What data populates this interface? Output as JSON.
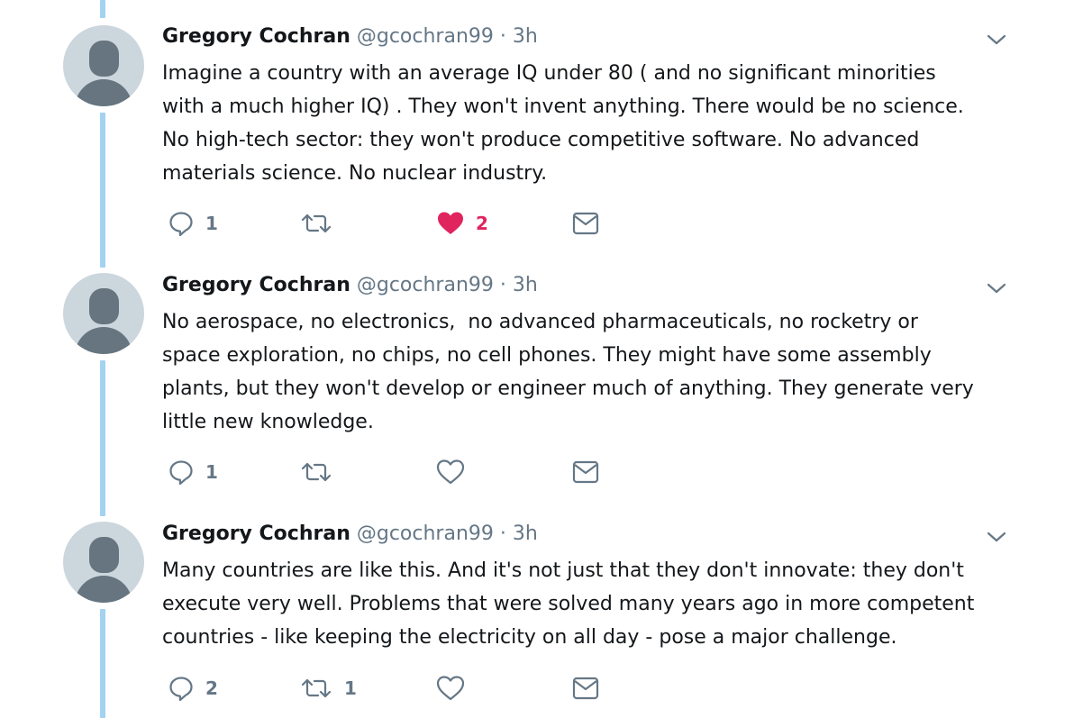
{
  "tweets": [
    {
      "name": "Gregory Cochran",
      "handle": "@gcochran99",
      "separator": "·",
      "time": "3h",
      "text": "Imagine a country with an average IQ under 80 ( and no significant minorities\nwith a much higher IQ) . They won't invent anything. There would be no science.\nNo high-tech sector: they won't produce competitive software. No advanced\nmaterials science. No nuclear industry.",
      "reply_count": "1",
      "retweet_count": "",
      "like_count": "2",
      "liked": true
    },
    {
      "name": "Gregory Cochran",
      "handle": "@gcochran99",
      "separator": "·",
      "time": "3h",
      "text": "No aerospace, no electronics,  no advanced pharmaceuticals, no rocketry or\nspace exploration, no chips, no cell phones. They might have some assembly\nplants, but they won't develop or engineer much of anything. They generate very\nlittle new knowledge.",
      "reply_count": "1",
      "retweet_count": "",
      "like_count": "",
      "liked": false
    },
    {
      "name": "Gregory Cochran",
      "handle": "@gcochran99",
      "separator": "·",
      "time": "3h",
      "text": "Many countries are like this. And it's not just that they don't innovate: they don't\nexecute very well. Problems that were solved many years ago in more competent\ncountries - like keeping the electricity on all day - pose a major challenge.",
      "reply_count": "2",
      "retweet_count": "1",
      "like_count": "",
      "liked": false
    }
  ],
  "icons": {
    "reply": "reply-icon",
    "retweet": "retweet-icon",
    "like": "heart-icon",
    "message": "envelope-icon",
    "menu": "chevron-down-icon"
  },
  "colors": {
    "thread_line": "#a3d2f3",
    "liked": "#e0245e",
    "icon": "#657786",
    "text": "#14171a"
  }
}
